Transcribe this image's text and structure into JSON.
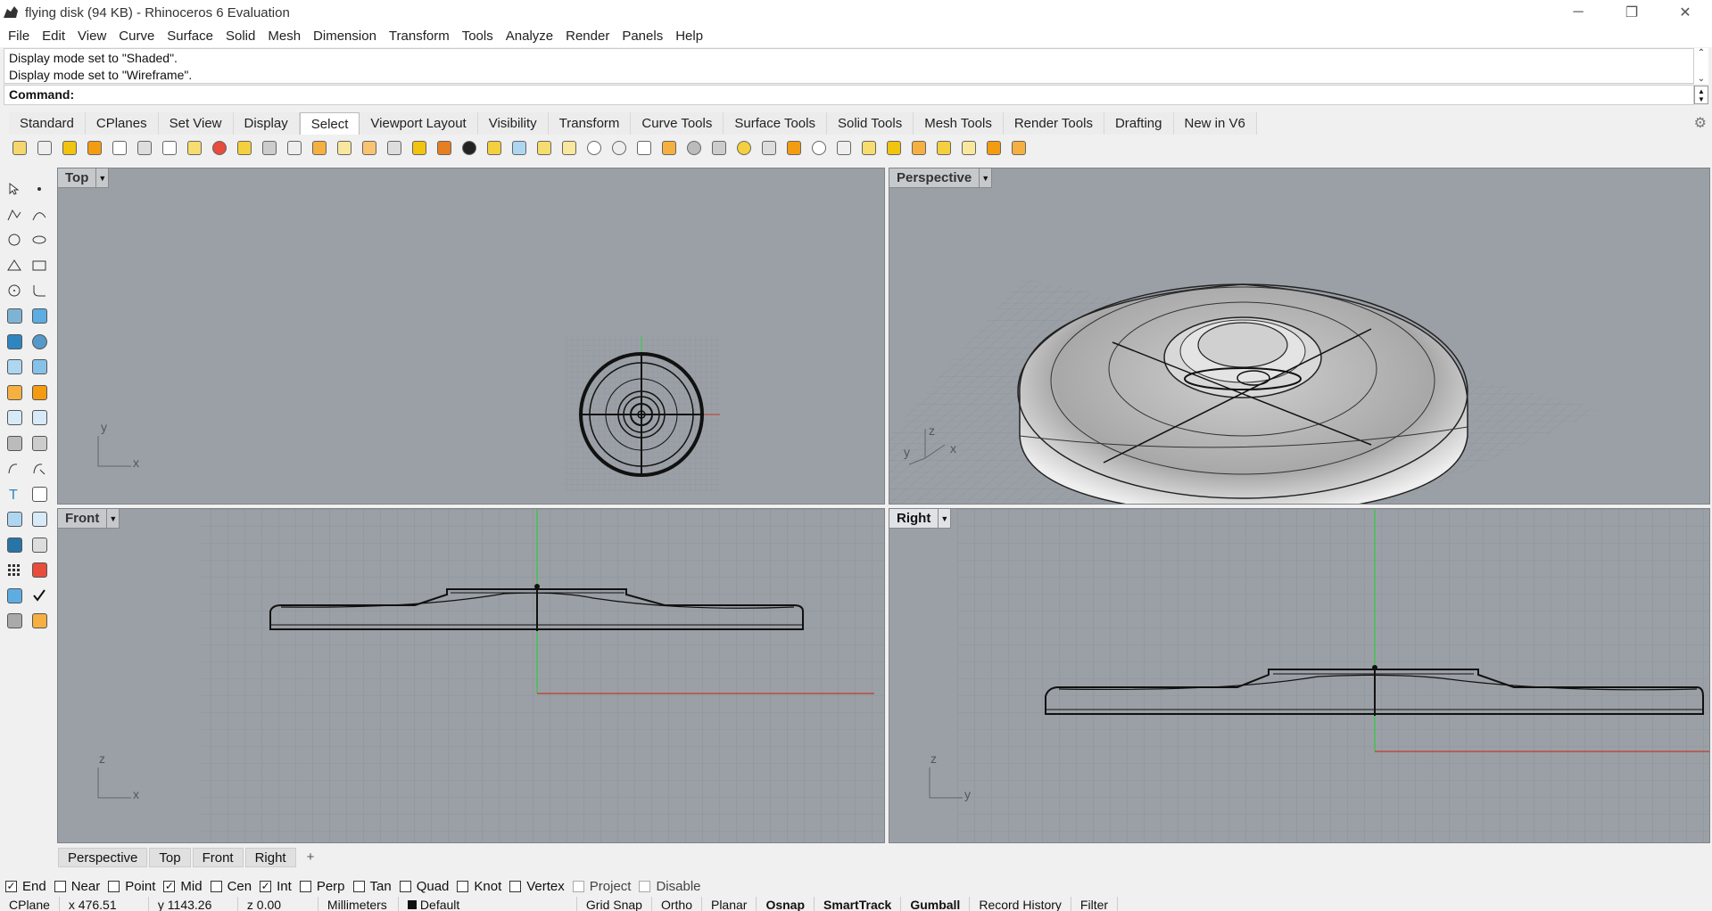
{
  "window": {
    "title": "flying disk (94 KB) - Rhinoceros 6 Evaluation",
    "minimize": "─",
    "restore": "❐",
    "close": "✕"
  },
  "menu": [
    "File",
    "Edit",
    "View",
    "Curve",
    "Surface",
    "Solid",
    "Mesh",
    "Dimension",
    "Transform",
    "Tools",
    "Analyze",
    "Render",
    "Panels",
    "Help"
  ],
  "command": {
    "history": [
      "Display mode set to \"Shaded\".",
      "Display mode set to \"Wireframe\"."
    ],
    "prompt_label": "Command:",
    "value": ""
  },
  "toolbar_tabs": [
    {
      "label": "Standard",
      "active": false
    },
    {
      "label": "CPlanes",
      "active": false
    },
    {
      "label": "Set View",
      "active": false
    },
    {
      "label": "Display",
      "active": false
    },
    {
      "label": "Select",
      "active": true
    },
    {
      "label": "Viewport Layout",
      "active": false
    },
    {
      "label": "Visibility",
      "active": false
    },
    {
      "label": "Transform",
      "active": false
    },
    {
      "label": "Curve Tools",
      "active": false
    },
    {
      "label": "Surface Tools",
      "active": false
    },
    {
      "label": "Solid Tools",
      "active": false
    },
    {
      "label": "Mesh Tools",
      "active": false
    },
    {
      "label": "Render Tools",
      "active": false
    },
    {
      "label": "Drafting",
      "active": false
    },
    {
      "label": "New in V6",
      "active": false
    }
  ],
  "viewports": {
    "top": {
      "label": "Top",
      "axis_a": "y",
      "axis_b": "x"
    },
    "perspective": {
      "label": "Perspective",
      "axis_a": "z",
      "axis_b": "y",
      "axis_c": "x"
    },
    "front": {
      "label": "Front",
      "axis_a": "z",
      "axis_b": "x"
    },
    "right": {
      "label": "Right",
      "axis_a": "z",
      "axis_b": "y",
      "active": true
    }
  },
  "viewport_tabs": [
    "Perspective",
    "Top",
    "Front",
    "Right"
  ],
  "viewport_tab_add": "+",
  "osnaps": [
    {
      "label": "End",
      "checked": true
    },
    {
      "label": "Near",
      "checked": false
    },
    {
      "label": "Point",
      "checked": false
    },
    {
      "label": "Mid",
      "checked": true
    },
    {
      "label": "Cen",
      "checked": false
    },
    {
      "label": "Int",
      "checked": true
    },
    {
      "label": "Perp",
      "checked": false
    },
    {
      "label": "Tan",
      "checked": false
    },
    {
      "label": "Quad",
      "checked": false
    },
    {
      "label": "Knot",
      "checked": false
    },
    {
      "label": "Vertex",
      "checked": false
    },
    {
      "label": "Project",
      "checked": false,
      "dim": true
    },
    {
      "label": "Disable",
      "checked": false,
      "dim": true
    }
  ],
  "status": {
    "cplane": "CPlane",
    "x": "x 476.51",
    "y": "y 1143.26",
    "z": "z 0.00",
    "units": "Millimeters",
    "layer": "Default",
    "grid_snap": "Grid Snap",
    "ortho": "Ortho",
    "planar": "Planar",
    "osnap": "Osnap",
    "smarttrack": "SmartTrack",
    "gumball": "Gumball",
    "record_history": "Record History",
    "filter": "Filter"
  },
  "colors": {
    "viewport_bg": "#9ba0a6",
    "grid_line": "#8a8f95",
    "axis_x": "#c0392b",
    "axis_y": "#27ae60"
  }
}
